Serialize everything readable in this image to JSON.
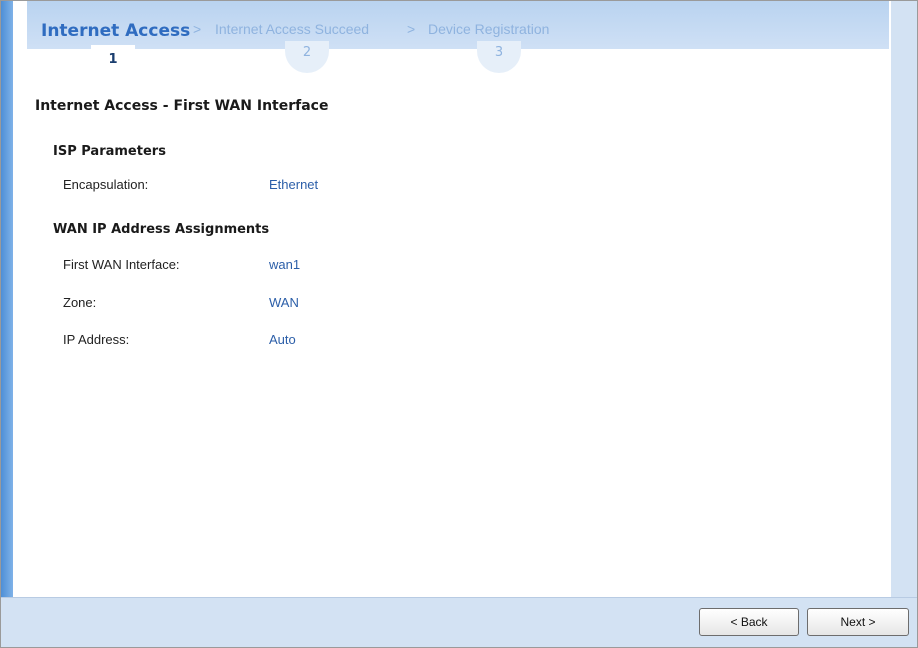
{
  "wizard": {
    "steps": [
      {
        "label": "Internet Access",
        "number": "1",
        "state": "active"
      },
      {
        "label": "Internet Access Succeed",
        "number": "2",
        "state": "inactive"
      },
      {
        "label": "Device Registration",
        "number": "3",
        "state": "inactive"
      }
    ],
    "separator": ">"
  },
  "page": {
    "title": "Internet Access - First WAN Interface",
    "isp_parameters": {
      "heading": "ISP Parameters",
      "encapsulation_label": "Encapsulation:",
      "encapsulation_value": "Ethernet"
    },
    "wan_ip": {
      "heading": "WAN IP Address Assignments",
      "first_wan_label": "First WAN Interface:",
      "first_wan_value": "wan1",
      "zone_label": "Zone:",
      "zone_value": "WAN",
      "ip_label": "IP Address:",
      "ip_value": "Auto"
    }
  },
  "footer": {
    "back_label": "< Back",
    "next_label": "Next >"
  },
  "colors": {
    "accent": "#2f6cc0",
    "inactive_step": "#8fb3df",
    "value_text": "#2b5ea8",
    "header_bg": "#c4daf3"
  }
}
